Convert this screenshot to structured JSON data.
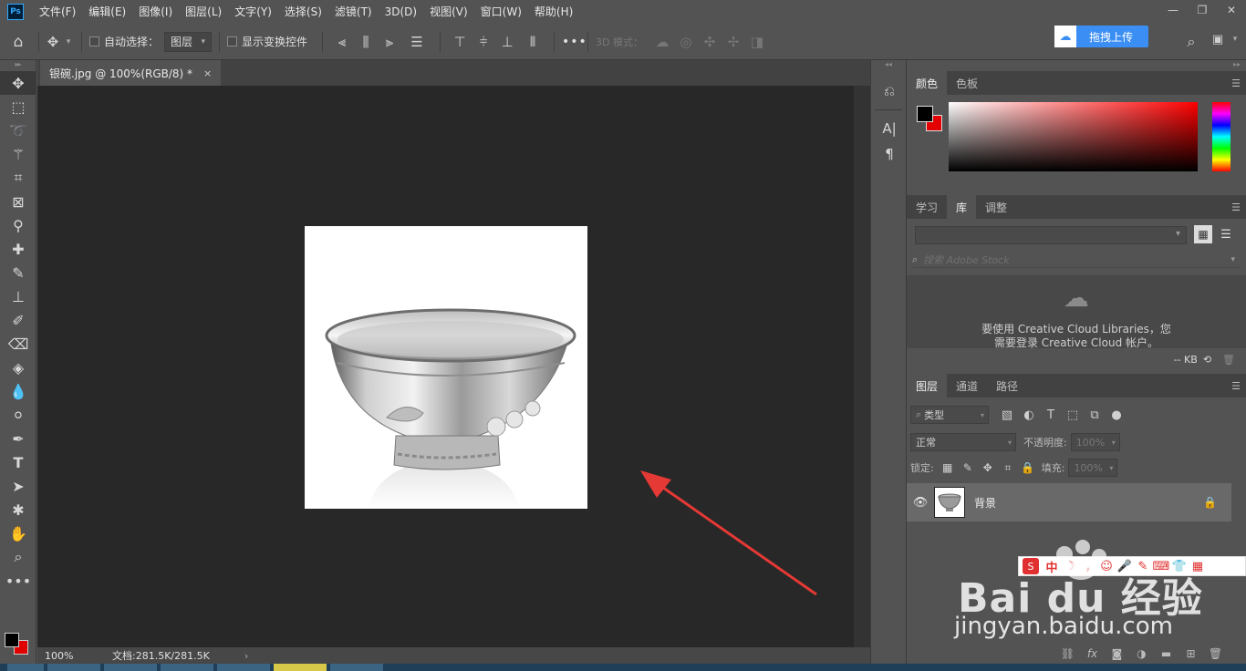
{
  "menu": {
    "logo": "Ps",
    "items": [
      "文件(F)",
      "编辑(E)",
      "图像(I)",
      "图层(L)",
      "文字(Y)",
      "选择(S)",
      "滤镜(T)",
      "3D(D)",
      "视图(V)",
      "窗口(W)",
      "帮助(H)"
    ]
  },
  "window_controls": {
    "minimize": "—",
    "restore": "❐",
    "close": "✕"
  },
  "options": {
    "auto_select_label": "自动选择：",
    "auto_select_target": "图层",
    "show_transform_label": "显示变换控件",
    "more": "•••",
    "mode_3d_label": "3D 模式：",
    "upload_label": "拖拽上传"
  },
  "document": {
    "tab_title": "银碗.jpg @ 100%(RGB/8) *",
    "tab_close": "×",
    "zoom": "100%",
    "doc_info": "文档:281.5K/281.5K",
    "status_arrow": "›"
  },
  "color_panel": {
    "tabs": [
      "颜色",
      "色板"
    ],
    "active_tab": "颜色",
    "foreground": "#000000",
    "background": "#e30000"
  },
  "library_panel": {
    "tabs": [
      "学习",
      "库",
      "调整"
    ],
    "active_tab": "库",
    "search_placeholder": "搜索 Adobe Stock",
    "message_line1": "要使用 Creative Cloud Libraries，您",
    "message_line2": "需要登录 Creative Cloud 帐户。",
    "footer_size": "-- KB"
  },
  "layers_panel": {
    "tabs": [
      "图层",
      "通道",
      "路径"
    ],
    "active_tab": "图层",
    "filter_kind": "类型",
    "blend_mode": "正常",
    "opacity_label": "不透明度:",
    "opacity_value": "100%",
    "lock_label": "锁定:",
    "fill_label": "填充:",
    "fill_value": "100%",
    "layers": [
      {
        "name": "背景",
        "visible": true,
        "locked": true
      }
    ]
  },
  "ime_bar": {
    "chinese": "中"
  },
  "watermark": {
    "main": "Bai du 经验",
    "sub": "jingyan.baidu.com"
  },
  "annotation": {
    "arrow_color": "#e53935"
  }
}
